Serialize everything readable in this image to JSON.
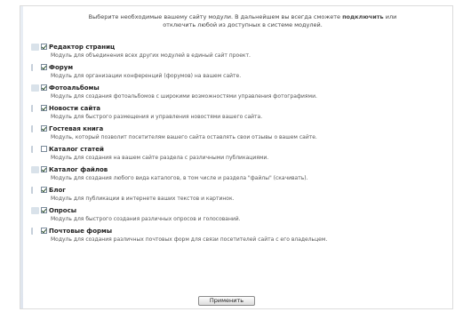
{
  "intro": {
    "line1_before": "Выберите необходимые вашему сайту модули. В дальнейшем вы всегда сможете ",
    "line1_bold": "подключить",
    "line1_after": " или",
    "line2": "отключить любой из доступных в системе модулей."
  },
  "modules": [
    {
      "marker": "icon",
      "checked": true,
      "title": "Редактор страниц",
      "desc": "Модуль для объединения всех других модулей в единый сайт проект."
    },
    {
      "marker": "blank",
      "checked": true,
      "title": "Форум",
      "desc": "Модуль для организации конференций (форумов) на вашем сайте."
    },
    {
      "marker": "icon",
      "checked": true,
      "title": "Фотоальбомы",
      "desc": "Модуль для создания фотоальбомов с широкими возможностями управления фотографиями."
    },
    {
      "marker": "blank",
      "checked": true,
      "title": "Новости сайта",
      "desc": "Модуль для быстрого размещения и управления новостями вашего сайта."
    },
    {
      "marker": "blank",
      "checked": true,
      "title": "Гостевая книга",
      "desc": "Модуль, который позволит посетителям вашего сайта оставлять свои отзывы о вашем сайте."
    },
    {
      "marker": "blank",
      "checked": false,
      "title": "Каталог статей",
      "desc": "Модуль для создания на вашем сайте раздела с различными публикациями."
    },
    {
      "marker": "icon",
      "checked": true,
      "title": "Каталог файлов",
      "desc": "Модуль для создания любого вида каталогов, в том числе и раздела \"файлы\" (скачивать)."
    },
    {
      "marker": "blank",
      "checked": true,
      "title": "Блог",
      "desc": "Модуль для публикации в интернете ваших текстов и картинок."
    },
    {
      "marker": "icon",
      "checked": true,
      "title": "Опросы",
      "desc": "Модуль для быстрого создания различных опросов и голосований."
    },
    {
      "marker": "blank",
      "checked": true,
      "title": "Почтовые формы",
      "desc": "Модуль для создания различных почтовых форм для связи посетителей сайта с его владельцем."
    }
  ],
  "submit_label": "Применить"
}
